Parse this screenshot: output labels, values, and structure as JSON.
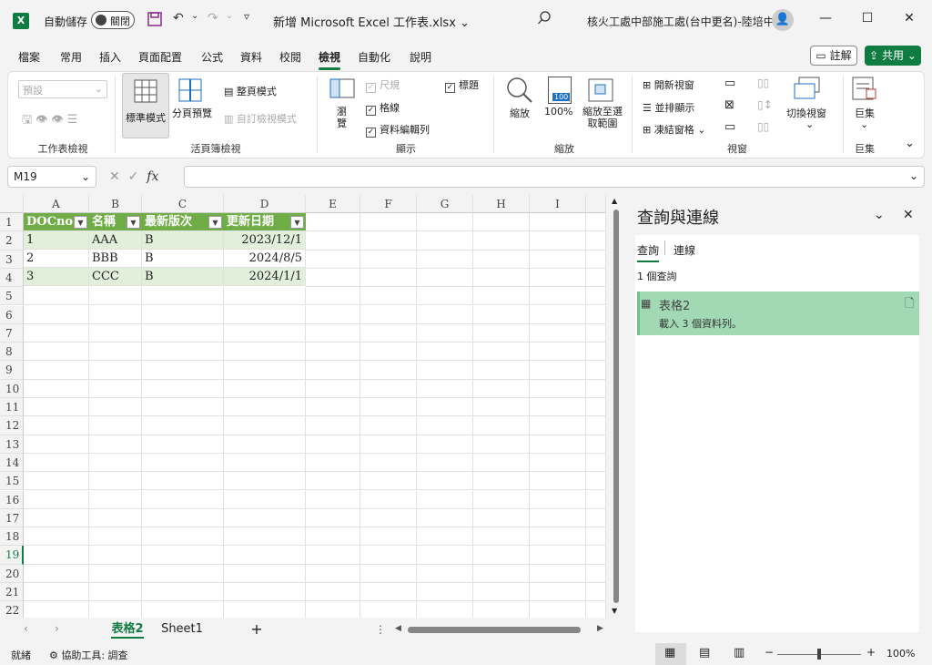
{
  "titlebar": {
    "logo": "X",
    "autosave_label": "自動儲存",
    "autosave_state": "關閉",
    "filename": "新增 Microsoft Excel 工作表.xlsx",
    "user": "核火工處中部施工處(台中更名)-陸培中",
    "icons": [
      "save-icon",
      "undo-icon",
      "redo-icon",
      "customize-icon",
      "search-icon",
      "minimize-icon",
      "restore-icon",
      "close-icon"
    ]
  },
  "menu": {
    "items": [
      "檔案",
      "常用",
      "插入",
      "頁面配置",
      "公式",
      "資料",
      "校閱",
      "檢視",
      "自動化",
      "說明"
    ],
    "active": "檢視",
    "comment": "註解",
    "share": "共用"
  },
  "ribbon": {
    "sheet_view": {
      "select": "預設",
      "label": "工作表檢視"
    },
    "workbook_views": {
      "normal": "標準模式",
      "page_break": "分頁預覽",
      "page_layout": "整頁模式",
      "custom": "自訂檢視模式",
      "label": "活頁簿檢視"
    },
    "show": {
      "navigation": "瀏覽",
      "ruler": "尺規",
      "gridlines": "格線",
      "formula_bar": "資料編輯列",
      "headings": "標題",
      "label": "顯示"
    },
    "zoom": {
      "zoom": "縮放",
      "zoom100": "100%",
      "zoom100_icon": "100",
      "zoom_selection": "縮放至選取範圍",
      "label": "縮放"
    },
    "window": {
      "new_window": "開新視窗",
      "arrange": "並排顯示",
      "freeze": "凍結窗格",
      "switch": "切換視窗",
      "label": "視窗"
    },
    "macros": {
      "macros": "巨集",
      "label": "巨集"
    }
  },
  "formula_bar": {
    "name_box": "M19",
    "fx": "fx",
    "formula": ""
  },
  "grid": {
    "columns": [
      "A",
      "B",
      "C",
      "D",
      "E",
      "F",
      "G",
      "H",
      "I"
    ],
    "rows": [
      "1",
      "2",
      "3",
      "4",
      "5",
      "6",
      "7",
      "8",
      "9",
      "10",
      "11",
      "12",
      "13",
      "14",
      "15",
      "16",
      "17",
      "18",
      "19",
      "20",
      "21",
      "22"
    ],
    "selected_row": "19",
    "table": {
      "headers": [
        "DOCno",
        "名稱",
        "最新版次",
        "更新日期"
      ],
      "rows": [
        [
          "1",
          "AAA",
          "B",
          "2023/12/1"
        ],
        [
          "2",
          "BBB",
          "B",
          "2024/8/5"
        ],
        [
          "3",
          "CCC",
          "B",
          "2024/1/1"
        ]
      ],
      "header_color": "#70ad47",
      "band_color": "#e2efda"
    }
  },
  "sheet_tabs": {
    "tabs": [
      "表格2",
      "Sheet1"
    ],
    "active": "表格2",
    "add": "+"
  },
  "pane": {
    "title": "查詢與連線",
    "tabs": [
      "查詢",
      "連線"
    ],
    "active_tab": "查詢",
    "count": "1 個查詢",
    "query_name": "表格2",
    "query_status": "載入 3 個資料列。"
  },
  "statusbar": {
    "ready": "就緒",
    "accessibility": "協助工具: 調查",
    "zoom": "100%",
    "zoom_minus": "−",
    "zoom_plus": "+"
  },
  "colors": {
    "accent": "#107c41",
    "table_header": "#70ad47",
    "query_card": "#a0d9b4"
  }
}
